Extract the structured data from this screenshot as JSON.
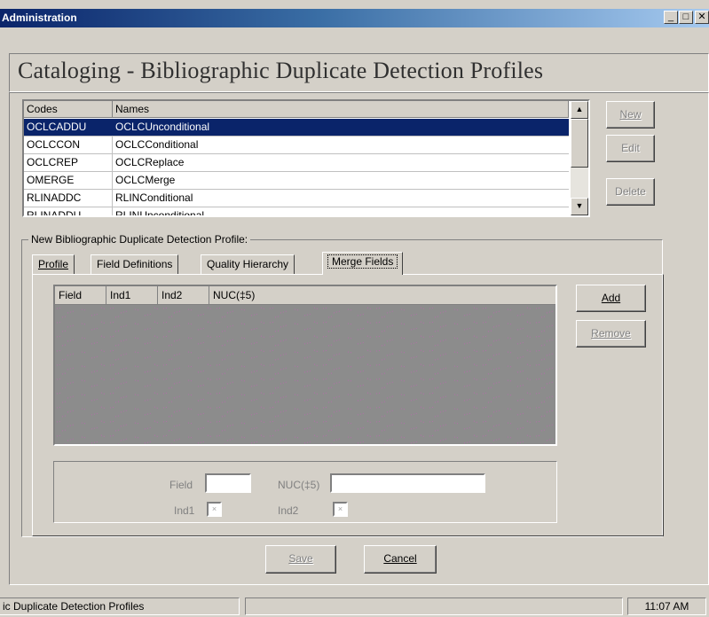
{
  "window": {
    "title": "Administration",
    "min_glyph": "_",
    "max_glyph": "□",
    "close_glyph": "✕"
  },
  "page_title": "Cataloging - Bibliographic Duplicate Detection Profiles",
  "list": {
    "columns": [
      "Codes",
      "Names"
    ],
    "rows": [
      {
        "code": "OCLCADDU",
        "name": "OCLCUnconditional",
        "selected": true
      },
      {
        "code": "OCLCCON",
        "name": "OCLCConditional",
        "selected": false
      },
      {
        "code": "OCLCREP",
        "name": "OCLCReplace",
        "selected": false
      },
      {
        "code": "OMERGE",
        "name": "OCLCMerge",
        "selected": false
      },
      {
        "code": "RLINADDC",
        "name": "RLINConditional",
        "selected": false
      },
      {
        "code": "RLINADDU",
        "name": "RLINUnconditional",
        "selected": false
      }
    ]
  },
  "side_buttons": {
    "new_label": "New",
    "edit_label": "Edit",
    "delete_label": "Delete"
  },
  "group_title": "New  Bibliographic Duplicate Detection Profile:",
  "tabs": [
    {
      "label": "Profile"
    },
    {
      "label": "Field Definitions"
    },
    {
      "label": "Quality Hierarchy"
    },
    {
      "label": "Merge Fields",
      "active": true
    }
  ],
  "merge_grid": {
    "columns": [
      "Field",
      "Ind1",
      "Ind2",
      "NUC(‡5)"
    ]
  },
  "merge_buttons": {
    "add_label": "Add",
    "remove_label": "Remove"
  },
  "edit_fields": {
    "field_label": "Field",
    "field_value": "",
    "nuc_label": "NUC(‡5)",
    "nuc_value": "",
    "ind1_label": "Ind1",
    "ind1_value": "×",
    "ind2_label": "Ind2",
    "ind2_value": "×"
  },
  "footer_buttons": {
    "save_label": "Save",
    "cancel_label": "Cancel"
  },
  "statusbar": {
    "text": "ic Duplicate Detection Profiles",
    "time": "11:07 AM"
  },
  "colors": {
    "titlebar": "#0a246a",
    "selection": "#0a246a",
    "face": "#d4d0c8",
    "grid_bg": "#8c8c8c"
  }
}
